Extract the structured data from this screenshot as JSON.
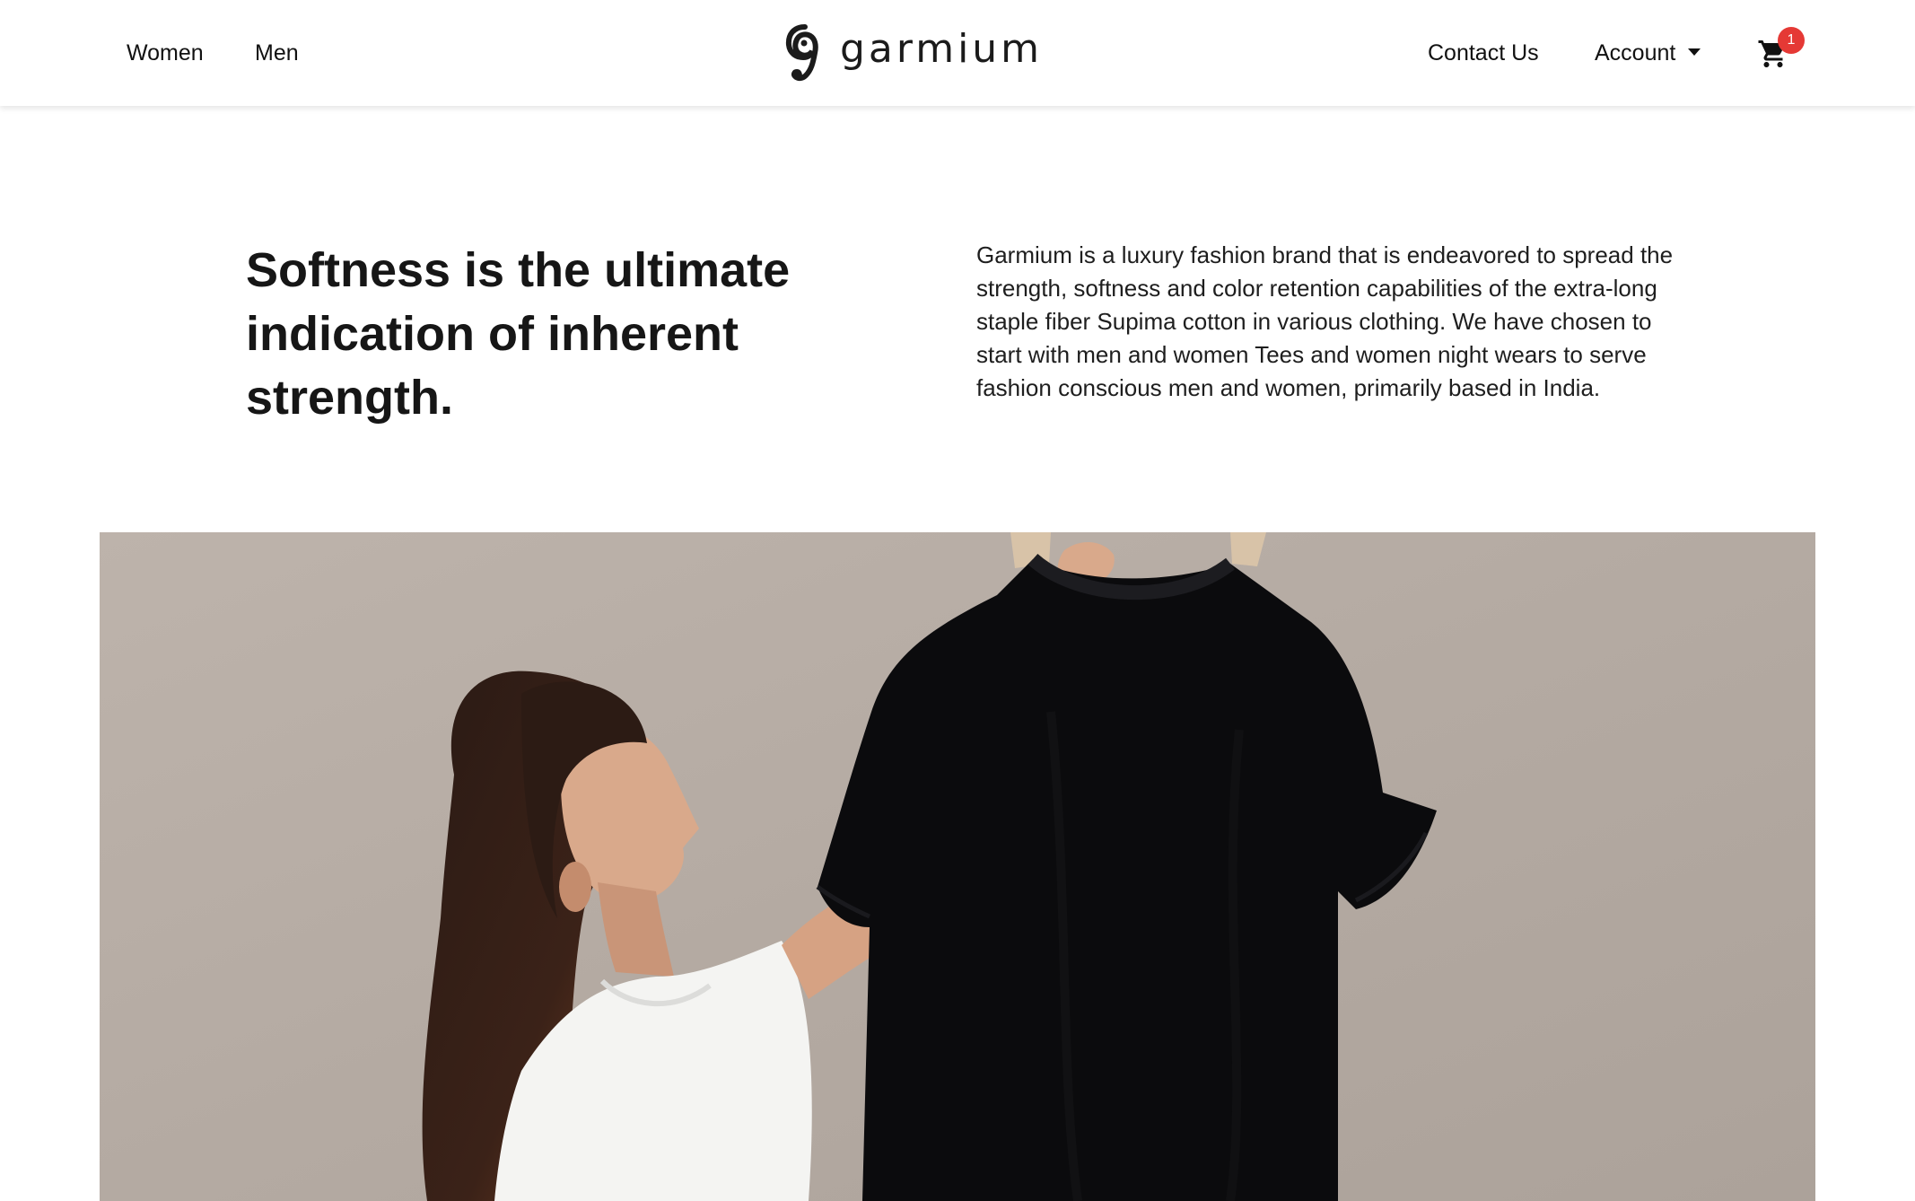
{
  "nav": {
    "left_links": [
      "Women",
      "Men"
    ],
    "logo_text": "garmium",
    "contact_label": "Contact Us",
    "account_label": "Account",
    "cart_count": "1"
  },
  "hero": {
    "headline": "Softness is the ultimate indication of inherent strength.",
    "description": "Garmium is a luxury fashion brand that is endeavored to spread the strength, softness and color retention capabilities of the extra-long staple fiber Supima cotton in various clothing. We have chosen to start with men and women Tees and women night wears to serve fashion conscious men and women, primarily based in India."
  },
  "colors": {
    "badge": "#e53935",
    "text": "#111111",
    "wall": "#b7ada5",
    "tee": "#0b0b0d"
  },
  "icons": {
    "logo": "garmium-logo-icon",
    "caret": "chevron-down-icon",
    "cart": "cart-icon"
  }
}
